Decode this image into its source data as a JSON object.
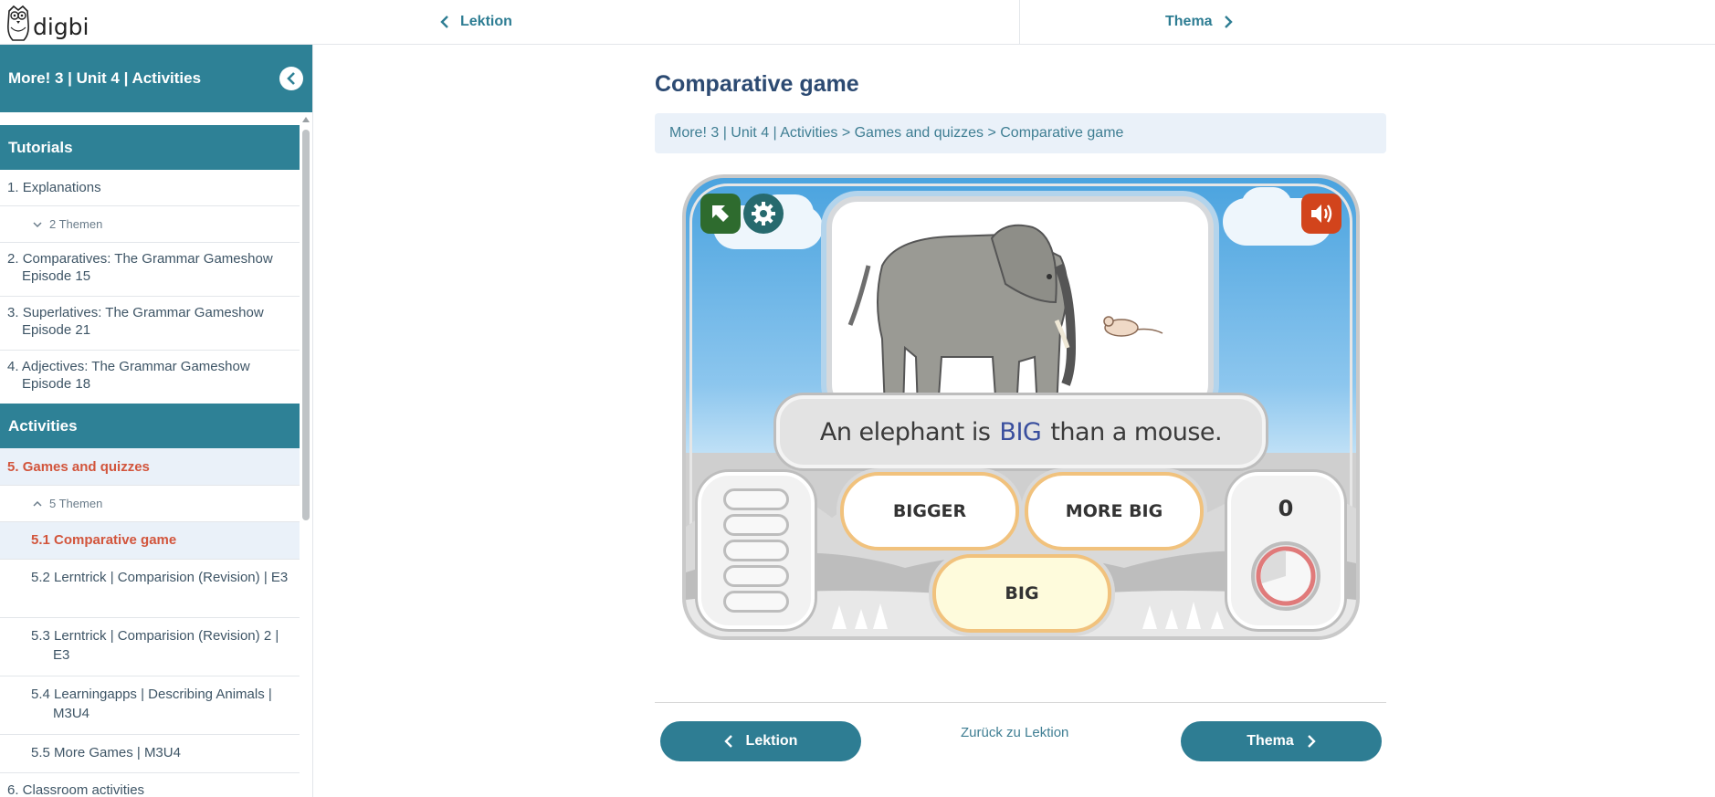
{
  "topbar": {
    "logo_text": "digbi",
    "prev_label": "Lektion",
    "next_label": "Thema"
  },
  "sidebar": {
    "title": "More! 3 | Unit 4 | Activities",
    "sections": {
      "tutorials": "Tutorials",
      "activities": "Activities"
    },
    "tutorial_items": [
      {
        "num": "1.",
        "label": "Explanations"
      },
      {
        "num": "2.",
        "label": "Comparatives: The Grammar Gameshow Episode 15"
      },
      {
        "num": "3.",
        "label": "Superlatives: The Grammar Gameshow Episode 21"
      },
      {
        "num": "4.",
        "label": "Adjectives: The Grammar Gameshow Episode 18"
      }
    ],
    "explanations_sub": "2 Themen",
    "group": {
      "num": "5.",
      "label": "Games and quizzes"
    },
    "group_sub": "5 Themen",
    "children": [
      {
        "label": "5.1 Comparative game"
      },
      {
        "label": "5.2 Lerntrick | Comparision (Revision) | E3"
      },
      {
        "label": "5.3 Lerntrick | Comparision (Revision) 2 | E3"
      },
      {
        "label": "5.4 Learningapps | Describing Animals | M3U4"
      },
      {
        "label": "5.5 More Games | M3U4"
      }
    ],
    "next_item": "6. Classroom activities"
  },
  "main": {
    "title": "Comparative game",
    "breadcrumb": "More! 3 | Unit 4 | Activities > Games and quizzes > Comparative game"
  },
  "game": {
    "sentence_start": "An elephant is",
    "sentence_blank": "BIG",
    "sentence_end": "than a mouse.",
    "answers": [
      "BIGGER",
      "MORE BIG",
      "BIG"
    ],
    "score": "0"
  },
  "footer": {
    "prev_label": "Lektion",
    "back_link": "Zurück zu Lektion",
    "next_label": "Thema"
  },
  "colors": {
    "brand": "#2e8196",
    "active": "#d2553c",
    "title": "#2c4a72"
  }
}
